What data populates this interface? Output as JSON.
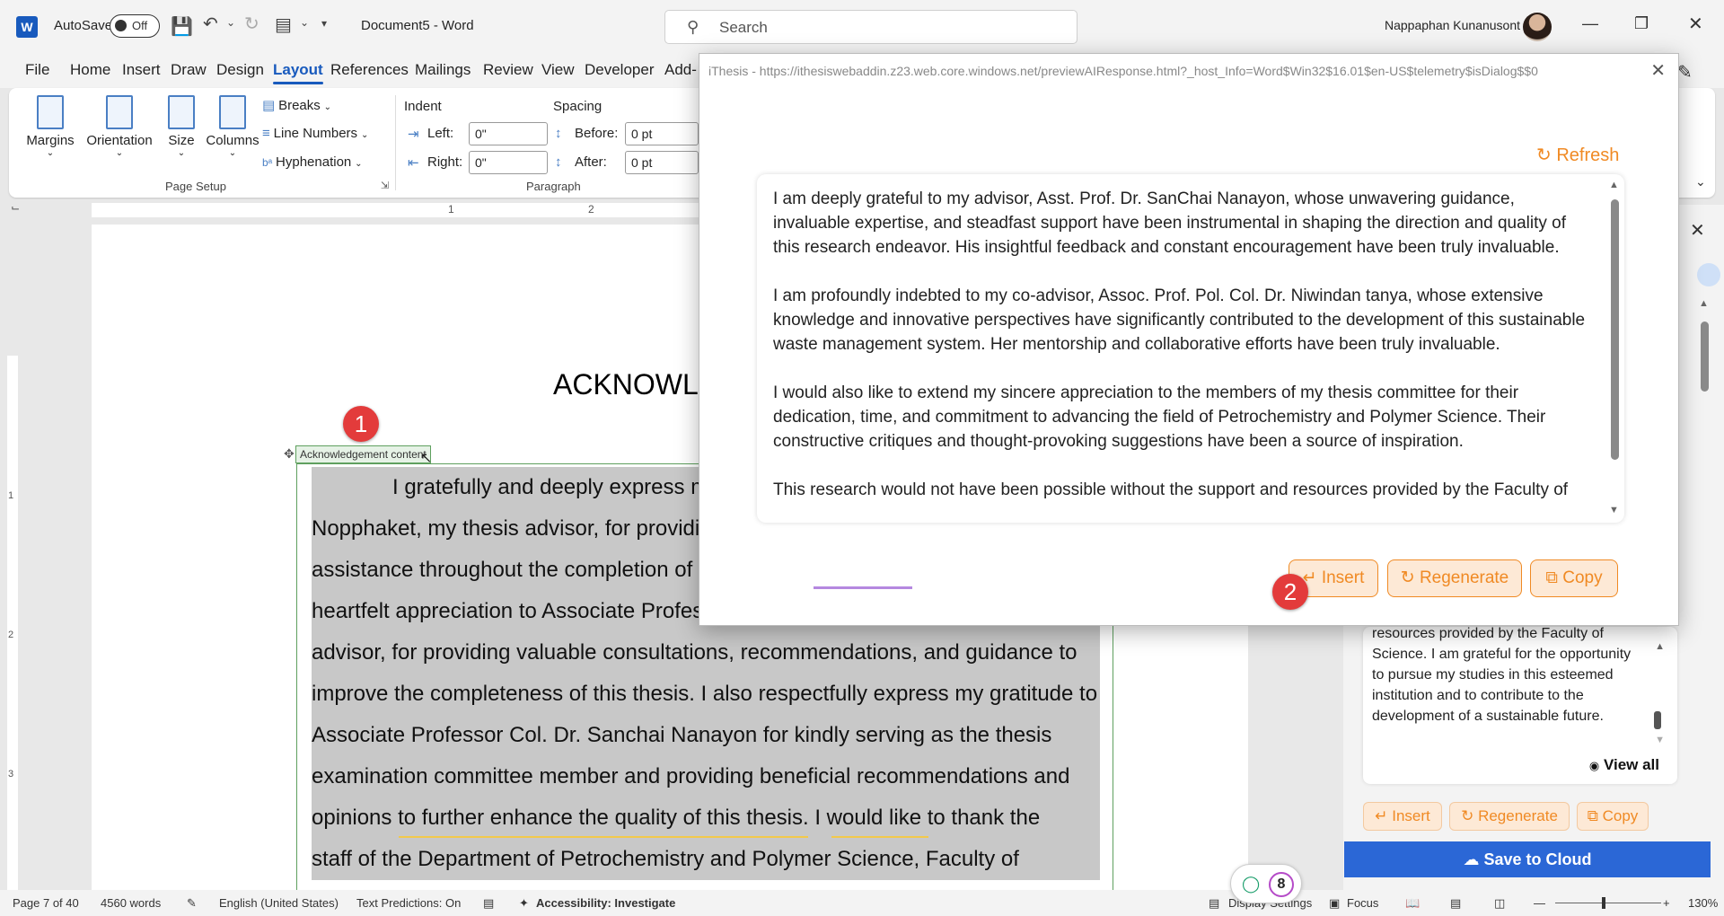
{
  "titlebar": {
    "app_logo": "W",
    "autosave_label": "AutoSave",
    "autosave_state": "Off",
    "document_title": "Document5  -  Word",
    "search_placeholder": "Search",
    "user_name": "Nappaphan Kunanusont"
  },
  "menu": {
    "tabs": [
      "File",
      "Home",
      "Insert",
      "Draw",
      "Design",
      "Layout",
      "References",
      "Mailings",
      "Review",
      "View",
      "Developer",
      "Add-"
    ],
    "active": "Layout"
  },
  "ribbon": {
    "page_setup": {
      "margins": "Margins",
      "orientation": "Orientation",
      "size": "Size",
      "columns": "Columns",
      "breaks": "Breaks",
      "line_numbers": "Line Numbers",
      "hyphenation": "Hyphenation",
      "group_label": "Page Setup"
    },
    "paragraph": {
      "indent_header": "Indent",
      "spacing_header": "Spacing",
      "left_label": "Left:",
      "left_value": "0\"",
      "right_label": "Right:",
      "right_value": "0\"",
      "before_label": "Before:",
      "before_value": "0 pt",
      "after_label": "After:",
      "after_value": "0 pt",
      "group_label": "Paragraph"
    }
  },
  "ruler": {
    "marks": [
      "1",
      "2"
    ]
  },
  "vruler": {
    "marks": [
      "1",
      "2",
      "3"
    ]
  },
  "document": {
    "heading": "ACKNOWLI",
    "content_control_tag": "Acknowledgement content",
    "lines": [
      "I gratefully and deeply express m",
      "Nopphaket, my thesis advisor, for providi",
      "assistance throughout the completion of",
      "heartfelt appreciation to Associate Profes",
      "advisor, for providing valuable consultations, recommendations, and guidance to",
      "improve the completeness of this thesis. I also respectfully express my gratitude to",
      "Associate Professor Col. Dr. Sanchai Nanayon for kindly serving as the thesis",
      "examination committee member and providing beneficial recommendations and",
      "opinions to further enhance the quality of this thesis. I would like to thank the",
      "staff of the Department of Petrochemistry and Polymer Science, Faculty of"
    ]
  },
  "badges": {
    "one": "1",
    "two": "2"
  },
  "dialog": {
    "title": "iThesis - https://ithesiswebaddin.z23.web.core.windows.net/previewAIResponse.html?_host_Info=Word$Win32$16.01$en-US$telemetry$isDialog$$0",
    "refresh": "Refresh",
    "paragraphs": [
      "I am deeply grateful to my advisor, Asst. Prof. Dr. SanChai Nanayon, whose unwavering guidance, invaluable expertise, and steadfast support have been instrumental in shaping the direction and quality of this research endeavor. His insightful feedback and constant encouragement have been truly invaluable.",
      "I am profoundly indebted to my co-advisor, Assoc. Prof. Pol. Col. Dr. Niwindan tanya, whose extensive knowledge and innovative perspectives have significantly contributed to the development of this sustainable waste management system. Her mentorship and collaborative efforts have been truly invaluable.",
      "I would also like to extend my sincere appreciation to the members of my thesis committee for their dedication, time, and commitment to advancing the field of Petrochemistry and Polymer Science. Their constructive critiques and thought-provoking suggestions have been a source of inspiration.",
      "This research would not have been possible without the support and resources provided by the Faculty of"
    ],
    "insert": "Insert",
    "regenerate": "Regenerate",
    "copy": "Copy"
  },
  "pane": {
    "text": "resources provided by the Faculty of Science. I am grateful for the opportunity to pursue my studies in this esteemed institution and to contribute to the development of a sustainable future.",
    "view_all": "View all",
    "insert": "Insert",
    "regenerate": "Regenerate",
    "copy": "Copy",
    "save_to_cloud": "Save to Cloud"
  },
  "pill": {
    "count": "8"
  },
  "statusbar": {
    "page": "Page 7 of 40",
    "words": "4560 words",
    "language": "English (United States)",
    "text_predictions": "Text Predictions: On",
    "accessibility": "Accessibility: Investigate",
    "display_settings": "Display Settings",
    "focus": "Focus",
    "zoom": "130%"
  },
  "colors": {
    "word_blue": "#185abd",
    "accent_orange": "#f08a24",
    "badge_red": "#e33b3b",
    "cloud_blue": "#2b67d6"
  }
}
